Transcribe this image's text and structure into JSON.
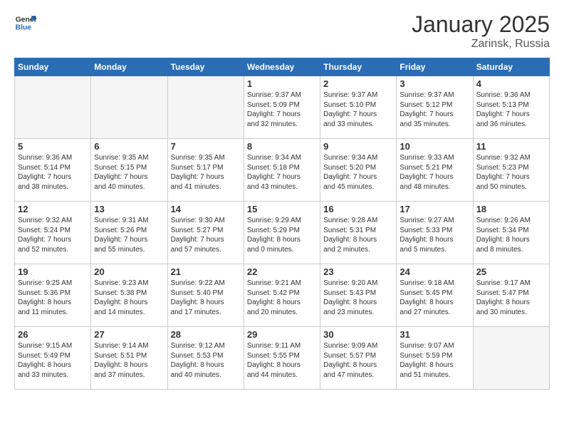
{
  "header": {
    "logo_general": "General",
    "logo_blue": "Blue",
    "month_title": "January 2025",
    "location": "Zarinsk, Russia"
  },
  "days_of_week": [
    "Sunday",
    "Monday",
    "Tuesday",
    "Wednesday",
    "Thursday",
    "Friday",
    "Saturday"
  ],
  "weeks": [
    [
      {
        "day": "",
        "empty": true
      },
      {
        "day": "",
        "empty": true
      },
      {
        "day": "",
        "empty": true
      },
      {
        "day": "1",
        "lines": [
          "Sunrise: 9:37 AM",
          "Sunset: 5:09 PM",
          "Daylight: 7 hours",
          "and 32 minutes."
        ]
      },
      {
        "day": "2",
        "lines": [
          "Sunrise: 9:37 AM",
          "Sunset: 5:10 PM",
          "Daylight: 7 hours",
          "and 33 minutes."
        ]
      },
      {
        "day": "3",
        "lines": [
          "Sunrise: 9:37 AM",
          "Sunset: 5:12 PM",
          "Daylight: 7 hours",
          "and 35 minutes."
        ]
      },
      {
        "day": "4",
        "lines": [
          "Sunrise: 9:36 AM",
          "Sunset: 5:13 PM",
          "Daylight: 7 hours",
          "and 36 minutes."
        ]
      }
    ],
    [
      {
        "day": "5",
        "lines": [
          "Sunrise: 9:36 AM",
          "Sunset: 5:14 PM",
          "Daylight: 7 hours",
          "and 38 minutes."
        ]
      },
      {
        "day": "6",
        "lines": [
          "Sunrise: 9:35 AM",
          "Sunset: 5:15 PM",
          "Daylight: 7 hours",
          "and 40 minutes."
        ]
      },
      {
        "day": "7",
        "lines": [
          "Sunrise: 9:35 AM",
          "Sunset: 5:17 PM",
          "Daylight: 7 hours",
          "and 41 minutes."
        ]
      },
      {
        "day": "8",
        "lines": [
          "Sunrise: 9:34 AM",
          "Sunset: 5:18 PM",
          "Daylight: 7 hours",
          "and 43 minutes."
        ]
      },
      {
        "day": "9",
        "lines": [
          "Sunrise: 9:34 AM",
          "Sunset: 5:20 PM",
          "Daylight: 7 hours",
          "and 45 minutes."
        ]
      },
      {
        "day": "10",
        "lines": [
          "Sunrise: 9:33 AM",
          "Sunset: 5:21 PM",
          "Daylight: 7 hours",
          "and 48 minutes."
        ]
      },
      {
        "day": "11",
        "lines": [
          "Sunrise: 9:32 AM",
          "Sunset: 5:23 PM",
          "Daylight: 7 hours",
          "and 50 minutes."
        ]
      }
    ],
    [
      {
        "day": "12",
        "lines": [
          "Sunrise: 9:32 AM",
          "Sunset: 5:24 PM",
          "Daylight: 7 hours",
          "and 52 minutes."
        ]
      },
      {
        "day": "13",
        "lines": [
          "Sunrise: 9:31 AM",
          "Sunset: 5:26 PM",
          "Daylight: 7 hours",
          "and 55 minutes."
        ]
      },
      {
        "day": "14",
        "lines": [
          "Sunrise: 9:30 AM",
          "Sunset: 5:27 PM",
          "Daylight: 7 hours",
          "and 57 minutes."
        ]
      },
      {
        "day": "15",
        "lines": [
          "Sunrise: 9:29 AM",
          "Sunset: 5:29 PM",
          "Daylight: 8 hours",
          "and 0 minutes."
        ]
      },
      {
        "day": "16",
        "lines": [
          "Sunrise: 9:28 AM",
          "Sunset: 5:31 PM",
          "Daylight: 8 hours",
          "and 2 minutes."
        ]
      },
      {
        "day": "17",
        "lines": [
          "Sunrise: 9:27 AM",
          "Sunset: 5:33 PM",
          "Daylight: 8 hours",
          "and 5 minutes."
        ]
      },
      {
        "day": "18",
        "lines": [
          "Sunrise: 9:26 AM",
          "Sunset: 5:34 PM",
          "Daylight: 8 hours",
          "and 8 minutes."
        ]
      }
    ],
    [
      {
        "day": "19",
        "lines": [
          "Sunrise: 9:25 AM",
          "Sunset: 5:36 PM",
          "Daylight: 8 hours",
          "and 11 minutes."
        ]
      },
      {
        "day": "20",
        "lines": [
          "Sunrise: 9:23 AM",
          "Sunset: 5:38 PM",
          "Daylight: 8 hours",
          "and 14 minutes."
        ]
      },
      {
        "day": "21",
        "lines": [
          "Sunrise: 9:22 AM",
          "Sunset: 5:40 PM",
          "Daylight: 8 hours",
          "and 17 minutes."
        ]
      },
      {
        "day": "22",
        "lines": [
          "Sunrise: 9:21 AM",
          "Sunset: 5:42 PM",
          "Daylight: 8 hours",
          "and 20 minutes."
        ]
      },
      {
        "day": "23",
        "lines": [
          "Sunrise: 9:20 AM",
          "Sunset: 5:43 PM",
          "Daylight: 8 hours",
          "and 23 minutes."
        ]
      },
      {
        "day": "24",
        "lines": [
          "Sunrise: 9:18 AM",
          "Sunset: 5:45 PM",
          "Daylight: 8 hours",
          "and 27 minutes."
        ]
      },
      {
        "day": "25",
        "lines": [
          "Sunrise: 9:17 AM",
          "Sunset: 5:47 PM",
          "Daylight: 8 hours",
          "and 30 minutes."
        ]
      }
    ],
    [
      {
        "day": "26",
        "lines": [
          "Sunrise: 9:15 AM",
          "Sunset: 5:49 PM",
          "Daylight: 8 hours",
          "and 33 minutes."
        ]
      },
      {
        "day": "27",
        "lines": [
          "Sunrise: 9:14 AM",
          "Sunset: 5:51 PM",
          "Daylight: 8 hours",
          "and 37 minutes."
        ]
      },
      {
        "day": "28",
        "lines": [
          "Sunrise: 9:12 AM",
          "Sunset: 5:53 PM",
          "Daylight: 8 hours",
          "and 40 minutes."
        ]
      },
      {
        "day": "29",
        "lines": [
          "Sunrise: 9:11 AM",
          "Sunset: 5:55 PM",
          "Daylight: 8 hours",
          "and 44 minutes."
        ]
      },
      {
        "day": "30",
        "lines": [
          "Sunrise: 9:09 AM",
          "Sunset: 5:57 PM",
          "Daylight: 8 hours",
          "and 47 minutes."
        ]
      },
      {
        "day": "31",
        "lines": [
          "Sunrise: 9:07 AM",
          "Sunset: 5:59 PM",
          "Daylight: 8 hours",
          "and 51 minutes."
        ]
      },
      {
        "day": "",
        "empty": true
      }
    ]
  ]
}
